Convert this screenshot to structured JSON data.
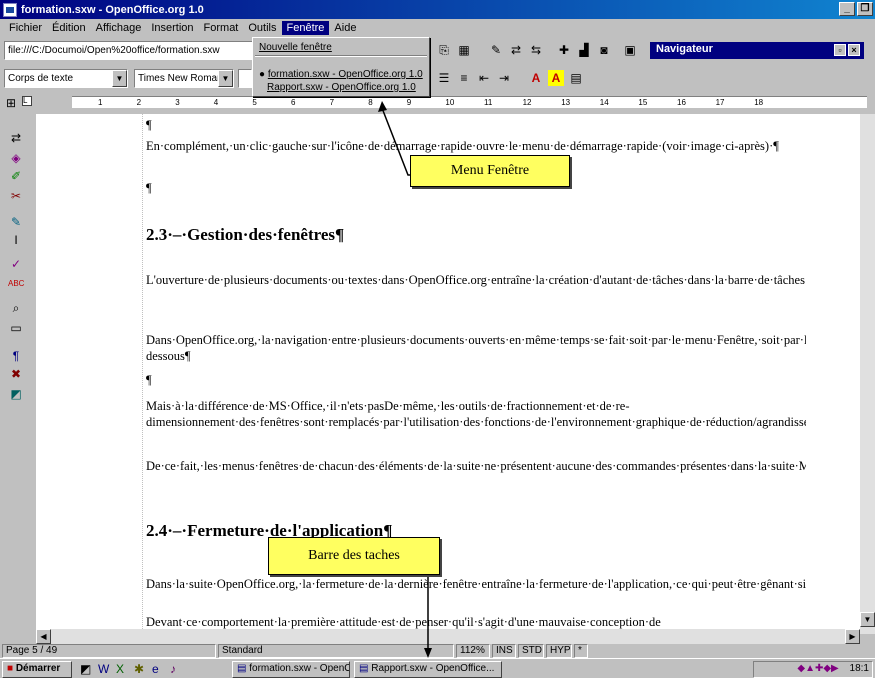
{
  "window": {
    "title": "formation.sxw - OpenOffice.org 1.0"
  },
  "menubar": {
    "items": [
      {
        "label": "Fichier"
      },
      {
        "label": "Édition"
      },
      {
        "label": "Affichage"
      },
      {
        "label": "Insertion"
      },
      {
        "label": "Format"
      },
      {
        "label": "Outils"
      },
      {
        "label": "Fenêtre"
      },
      {
        "label": "Aide"
      }
    ]
  },
  "toolbar": {
    "url": "file:///C:/Documoi/Open%20office/formation.sxw",
    "navigator_title": "Navigateur"
  },
  "format": {
    "style": "Corps de texte",
    "font": "Times New Roman"
  },
  "fenetre_menu": {
    "new_window": "Nouvelle fenêtre",
    "doc1": "formation.sxw - OpenOffice.org 1.0",
    "doc2": "Rapport.sxw - OpenOffice.org 1.0"
  },
  "ruler": {
    "numbers": [
      "1",
      "2",
      "3",
      "4",
      "5",
      "6",
      "7",
      "8",
      "9",
      "10",
      "11",
      "12",
      "13",
      "14",
      "15",
      "16",
      "17",
      "18"
    ]
  },
  "document": {
    "para0": "¶",
    "para1": "En·complément,·un·clic·gauche·sur·l'icône·de·démarrage·rapide·ouvre·le·menu·de·démarrage·rapide·(voir·image·ci-après)·¶",
    "para2": "¶",
    "heading1": "2.3·–·Gestion·des·fenêtres¶",
    "para3": "L'ouverture·de·plusieurs·documents·ou·textes·dans·OpenOffice.org·entraîne·la·création·d'autant·de·tâches·dans·la·barre·de·tâches·de·Windows.·Les·versions·postérieures·à·MS·Office·97·ont·d'ailleurs·le·même·comportement.¶",
    "para4": "Dans·OpenOffice.org,·la·navigation·entre·plusieurs·documents·ouverts·en·même·temps·se·fait·soit·par·le·menu·Fenêtre,·soit·par·la·barre·des·tâches·de·Windows·ainsi·que·le·montre·l'image·ci-dessous¶",
    "para5": "¶",
    "para6": "Mais·à·la·différence·de·MS·Office,·il·n'ets·pasDe·même,·les·outils·de·fractionnement·et·de·re-dimensionnement·des·fenêtres·sont·remplacés·par·l'utilisation·des·fonctions·de·l'environnement·graphique·de·réduction/agrandissement,·de·positionnement·et·de·dimensionnement·des·fenêtres.¶",
    "para7": "De·ce·fait,·les·menus·fenêtres·de·chacun·des·éléments·de·la·suite·ne·présentent·aucune·des·commandes·présentes·dans·la·suite·MS·Office¶",
    "heading2": "2.4·–·Fermeture·de·l'application¶",
    "para8": "Dans·la·suite·OpenOffice.org,·la·fermeture·de·la·dernière·fenêtre·entraîne·la·fermeture·de·l'application,·ce·qui·peut·être·gênant·si·l'on·veut·ouvrir·un·fichier·:·il·est·en·effet·nécessaire·de·redémarrer·l'application.¶",
    "para9": "Devant·ce·comportement·la·première·attitude·est·de·penser·qu'il·s'agit·d'une·mauvaise·conception·de"
  },
  "callouts": {
    "menu": "Menu Fenêtre",
    "taskbar": "Barre des taches"
  },
  "status": {
    "page": "Page 5 / 49",
    "style": "Standard",
    "zoom": "112%",
    "ins": "INS",
    "std": "STD",
    "hyp": "HYP",
    "star": "*"
  },
  "taskbar": {
    "start": "Démarrer",
    "task1": "formation.sxw - OpenOffice...",
    "task2": "Rapport.sxw - OpenOffice...",
    "clock": "18:1"
  }
}
